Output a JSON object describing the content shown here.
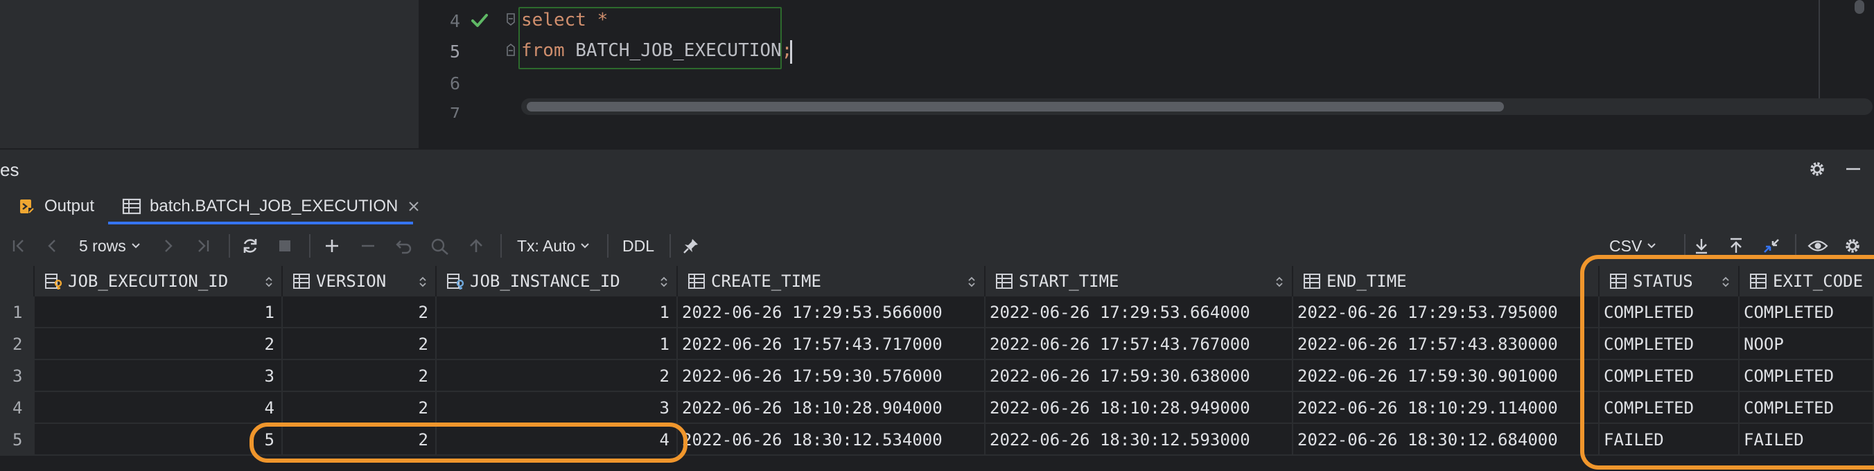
{
  "editor": {
    "line_numbers": [
      "4",
      "5",
      "6",
      "7"
    ],
    "line4": {
      "keyword": "select",
      "rest": " *"
    },
    "line5": {
      "keyword": "from",
      "table": " BATCH_JOB_EXECUTION",
      "semicolon": ";"
    }
  },
  "panel": {
    "title": "es"
  },
  "tabs": [
    {
      "label": "Output",
      "icon": "output-icon"
    },
    {
      "label": "batch.BATCH_JOB_EXECUTION",
      "icon": "table-icon",
      "active": true
    }
  ],
  "toolbar": {
    "rows_label": "5 rows",
    "tx_label": "Tx: Auto",
    "ddl_label": "DDL",
    "export_label": "CSV"
  },
  "grid": {
    "columns": [
      "JOB_EXECUTION_ID",
      "VERSION",
      "JOB_INSTANCE_ID",
      "CREATE_TIME",
      "START_TIME",
      "END_TIME",
      "STATUS",
      "EXIT_CODE"
    ],
    "rows": [
      {
        "num": "1",
        "job_execution_id": "1",
        "version": "2",
        "job_instance_id": "1",
        "create_time": "2022-06-26 17:29:53.566000",
        "start_time": "2022-06-26 17:29:53.664000",
        "end_time": "2022-06-26 17:29:53.795000",
        "status": "COMPLETED",
        "exit_code": "COMPLETED"
      },
      {
        "num": "2",
        "job_execution_id": "2",
        "version": "2",
        "job_instance_id": "1",
        "create_time": "2022-06-26 17:57:43.717000",
        "start_time": "2022-06-26 17:57:43.767000",
        "end_time": "2022-06-26 17:57:43.830000",
        "status": "COMPLETED",
        "exit_code": "NOOP"
      },
      {
        "num": "3",
        "job_execution_id": "3",
        "version": "2",
        "job_instance_id": "2",
        "create_time": "2022-06-26 17:59:30.576000",
        "start_time": "2022-06-26 17:59:30.638000",
        "end_time": "2022-06-26 17:59:30.901000",
        "status": "COMPLETED",
        "exit_code": "COMPLETED"
      },
      {
        "num": "4",
        "job_execution_id": "4",
        "version": "2",
        "job_instance_id": "3",
        "create_time": "2022-06-26 18:10:28.904000",
        "start_time": "2022-06-26 18:10:28.949000",
        "end_time": "2022-06-26 18:10:29.114000",
        "status": "COMPLETED",
        "exit_code": "COMPLETED"
      },
      {
        "num": "5",
        "job_execution_id": "5",
        "version": "2",
        "job_instance_id": "4",
        "create_time": "2022-06-26 18:30:12.534000",
        "start_time": "2022-06-26 18:30:12.593000",
        "end_time": "2022-06-26 18:30:12.684000",
        "status": "FAILED",
        "exit_code": "FAILED"
      }
    ]
  },
  "colors": {
    "highlight": "#f0962c",
    "keyword": "#cf8e6d",
    "accent": "#3574f0"
  }
}
